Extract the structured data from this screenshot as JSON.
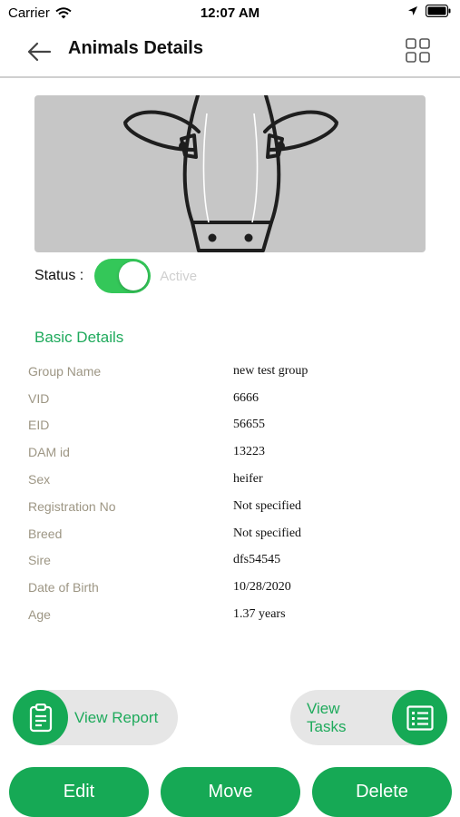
{
  "status_bar": {
    "carrier": "Carrier",
    "time": "12:07 AM"
  },
  "nav": {
    "title": "Animals Details"
  },
  "animal": {
    "status_label": "Status :",
    "status_value": "Active",
    "status_on": true
  },
  "basic_details": {
    "title": "Basic Details",
    "rows": [
      {
        "label": "Group Name",
        "value": "new test group"
      },
      {
        "label": "VID",
        "value": "6666"
      },
      {
        "label": "EID",
        "value": "56655"
      },
      {
        "label": "DAM id",
        "value": "13223"
      },
      {
        "label": "Sex",
        "value": "heifer"
      },
      {
        "label": "Registration No",
        "value": "Not specified"
      },
      {
        "label": "Breed",
        "value": "Not specified"
      },
      {
        "label": "Sire",
        "value": "dfs54545"
      },
      {
        "label": "Date of Birth",
        "value": "10/28/2020"
      },
      {
        "label": "Age",
        "value": "1.37 years"
      }
    ]
  },
  "buttons": {
    "view_report": "View Report",
    "view_tasks": "View Tasks",
    "edit": "Edit",
    "move": "Move",
    "delete": "Delete"
  },
  "colors": {
    "brand_green": "#16a955",
    "toggle_green": "#34c759",
    "label_gray": "#9d9684"
  },
  "icons": [
    "wifi-icon",
    "location-arrow-icon",
    "battery-icon",
    "back-arrow-icon",
    "grid-icon",
    "cow-face-icon",
    "clipboard-icon",
    "task-list-icon"
  ]
}
